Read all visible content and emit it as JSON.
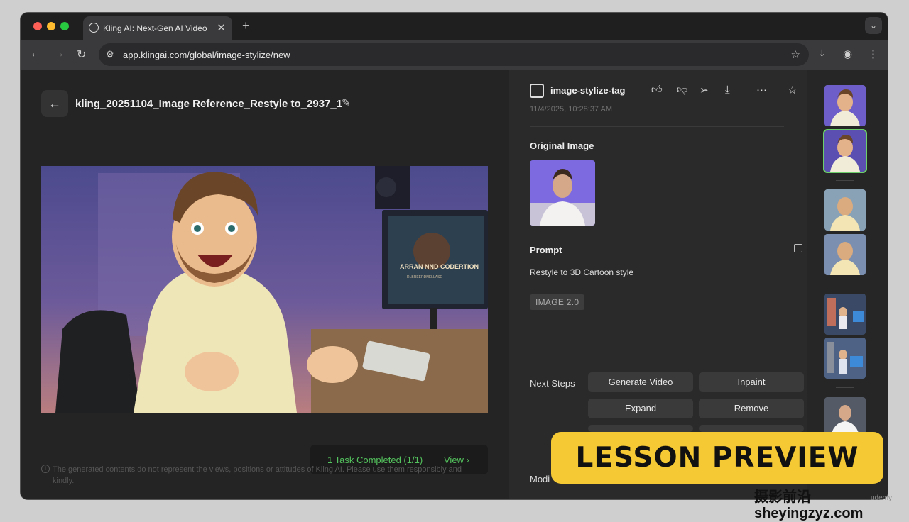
{
  "browser": {
    "tab_title": "Kling AI: Next-Gen AI Video &",
    "tab_close": "✕",
    "new_tab": "+",
    "url": "app.klingai.com/global/image-stylize/new"
  },
  "left": {
    "filename": "kling_20251104_Image Reference_Restyle to_2937_1",
    "image_sign_title": "ARRAN NND CODERTION",
    "image_sign_sub": "RLBREERDNELLASE",
    "toast_text": "1 Task Completed  (1/1)",
    "toast_view": "View  ›",
    "disclaimer": "The generated contents do not represent the views, positions or attitudes of Kling AI. Please use them responsibly and kindly."
  },
  "right": {
    "tag": "image-stylize-tag",
    "timestamp": "11/4/2025, 10:28:37 AM",
    "original_label": "Original Image",
    "prompt_label": "Prompt",
    "prompt_text": "Restyle to 3D Cartoon style",
    "model_badge": "IMAGE 2.0",
    "next_steps_label": "Next Steps",
    "buttons": [
      "Generate Video",
      "Inpaint",
      "Expand",
      "Remove"
    ],
    "model_label": "Modi"
  },
  "overlay": {
    "lesson": "LESSON PREVIEW",
    "watermark": "摄影前沿 sheyingzyz.com",
    "watermark_small": "udemy"
  },
  "colors": {
    "accent_green": "#54c45e",
    "banner_yellow": "#f5c934"
  }
}
